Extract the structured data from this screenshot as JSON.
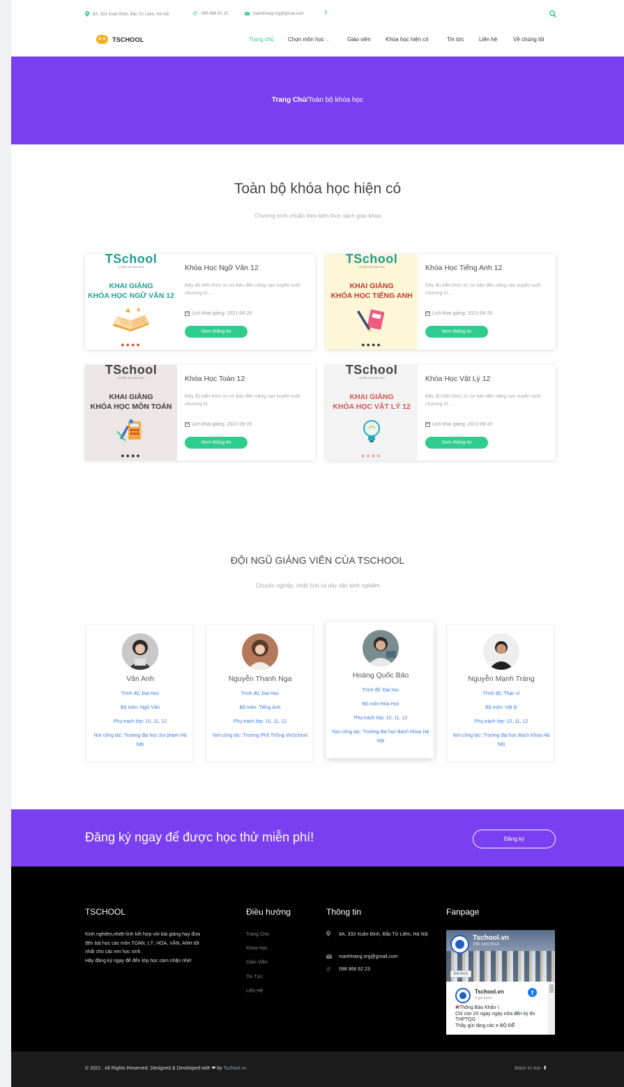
{
  "topbar": {
    "address": "8A, 333 Xuân Đỉnh, Bắc Từ Liêm, Hà Nội",
    "phone": "098 868 62 23",
    "email": "manhtrang.org@gmail.com",
    "facebook_glyph": "f"
  },
  "brand": {
    "logo_text": "TSCHOOL"
  },
  "nav": {
    "items": [
      "Trang chủ",
      "Chọn môn học",
      "Giáo viên",
      "Khóa học hiện có",
      "Tin tức",
      "Liên hệ",
      "Về chúng tôi"
    ]
  },
  "hero": {
    "breadcrumb_home": "Trang Chủ",
    "breadcrumb_sep": "/",
    "breadcrumb_current": "Toàn bộ khóa học"
  },
  "courses_section": {
    "title": "Toàn bộ khóa học hiện có",
    "subtitle": "Chương trình chuẩn theo kiến thức sách giáo khoa"
  },
  "courses": [
    {
      "image": {
        "brand": "TSchool",
        "brand_sub": "LUYỆN THI ĐẠI HỌC",
        "kg": "KHAI GIẢNG",
        "course": "KHÓA HỌC NGỮ VĂN 12",
        "dots": "●●●●"
      },
      "title": "Khóa Học Ngữ Văn 12",
      "desc": "Đây đủ kiến thức từ cơ bản đến nâng cao xuyên suốt chương trì...",
      "date": "Lịch khai giảng: 2021-06-20",
      "button": "Xem thông tin"
    },
    {
      "image": {
        "brand": "TSchool",
        "brand_sub": "LUYỆN THI ĐẠI HỌC",
        "kg": "KHAI GIẢNG",
        "course": "KHÓA HỌC TIẾNG ANH",
        "dots": "●●●●"
      },
      "title": "Khóa Học Tiếng Anh 12",
      "desc": "Đây đủ kiến thức từ cơ bản đến nâng cao xuyên suốt chương trì...",
      "date": "Lịch khai giảng: 2021-06-20",
      "button": "Xem thông tin"
    },
    {
      "image": {
        "brand": "TSchool",
        "brand_sub": "LUYỆN THI ĐẠI HỌC",
        "kg": "KHAI GIẢNG",
        "course": "KHÓA HỌC MÔN TOÁN",
        "dots": "●●●●"
      },
      "title": "Khóa Học Toán 12",
      "desc": "Đây đủ kiến thức từ cơ bản đến nâng cao xuyên suốt chương trì...",
      "date": "Lịch khai giảng: 2021-06-25",
      "button": "Xem thông tin"
    },
    {
      "image": {
        "brand": "TSchool",
        "brand_sub": "LUYỆN THI ĐẠI HỌC",
        "kg": "KHAI GIẢNG",
        "course": "KHÓA HỌC VẬT LÝ 12",
        "dots": "●●●●"
      },
      "title": "Khóa Học Vật Lý 12",
      "desc": "Đây đủ kiến thức từ cơ bản đến nâng cao xuyên suốt chương trì...",
      "date": "Lịch khai giảng: 2021-06-20",
      "button": "Xem thông tin"
    }
  ],
  "teachers_section": {
    "title": "ĐỘI NGŨ GIẢNG VIÊN CỦA TSCHOOL",
    "subtitle": "Chuyên nghiệp, nhiệt tình và dày dặn kinh nghiệm"
  },
  "teachers": [
    {
      "name": "Vân Anh",
      "level": "Trình độ: Đại Học",
      "subject": "Bộ môn: Ngữ Văn",
      "classes": "Phụ trách lớp: 10, 11, 12",
      "workplace": "Nơi công tác: Trường đại học Sư phạm Hà Nội"
    },
    {
      "name": "Nguyễn Thanh Nga",
      "level": "Trình độ: Đại Học",
      "subject": "Bộ môn: Tiếng Anh",
      "classes": "Phụ trách lớp: 10, 11, 12",
      "workplace": "Nơi công tác: Trường Phổ Thông VinSchool"
    },
    {
      "name": "Hoàng Quốc Bảo",
      "level": "Trình độ: Đại học",
      "subject": "Bộ môn:Hóa Học",
      "classes": "Phụ trách lớp: 10, 11, 12",
      "workplace": "Nơi công tác: Trường đại học Bách Khoa Hà Nội"
    },
    {
      "name": "Nguyễn Mạnh Tráng",
      "level": "Trình độ: Thạc sĩ",
      "subject": "Bộ môn: Vật lý",
      "classes": "Phụ trách lớp: 10, 11, 12",
      "workplace": "Nơi công tác: Trường đại học Bách Khoa Hà Nội"
    }
  ],
  "cta": {
    "text": "Đăng ký ngay để được học thử miễn phí!",
    "button": "Đăng ký"
  },
  "footer": {
    "about_title": "TSCHOOL",
    "about_text": "Kinh nghiệm,nhiệt tình kết hợp với bài giảng hay đưa đến bài học các môn TOÁN, LÝ, HÓA, VĂN, ANH tốt nhất cho các em học sinh.",
    "about_text2": "Hãy đăng ký ngay để đến lớp học cảm nhận nhé!",
    "nav_title": "Điều hướng",
    "nav_links": [
      "Trang Chủ",
      "Khóa Học",
      "Giáo Viên",
      "Tin Tức",
      "Liên Hệ"
    ],
    "info_title": "Thông tin",
    "info_address": "8A, 333 Xuân Đỉnh, Bắc Từ Liêm, Hà Nội",
    "info_email": "manhtrang.org@gmail.com",
    "info_phone": "098 868 62 23",
    "fanpage_title": "Fanpage",
    "fanpage": {
      "page_name": "Tschool.vn",
      "likes": "15K lượt thích",
      "like_button": "Đã thích",
      "post_author": "Tschool.vn",
      "post_time": "6 giờ trước",
      "post_line1": "Thông Báo Khẩn",
      "post_line2": "Chỉ còn 20 ngày ngày nữa đến kỳ thi THPTQG",
      "post_line3": "Thầy gửi tặng các e BỘ ĐỀ"
    }
  },
  "bottom": {
    "copyright": "© 2021 . All Rights Reserved. Designed & Developed with",
    "by": "by",
    "brand": "Tschool.vn",
    "back_to_top": "Back to top"
  },
  "colors": {
    "purple": "#7a3ff0",
    "green": "#2ecc8e",
    "link_blue": "#3b7be0"
  }
}
